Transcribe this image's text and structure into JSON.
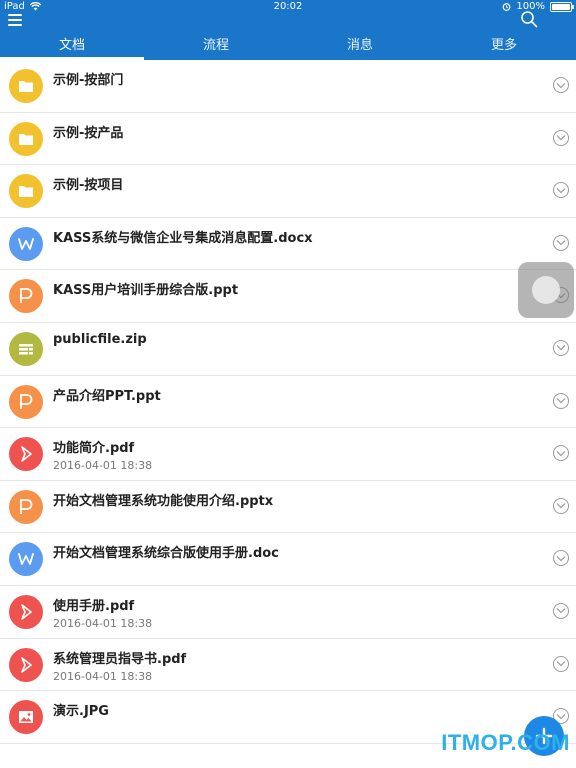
{
  "status_bar": {
    "device": "iPad",
    "time": "20:02",
    "battery": "100%"
  },
  "tabs": [
    {
      "label": "文档",
      "active": true
    },
    {
      "label": "流程",
      "active": false
    },
    {
      "label": "消息",
      "active": false
    },
    {
      "label": "更多",
      "active": false
    }
  ],
  "files": [
    {
      "name": "示例-按部门",
      "date": "",
      "type": "folder",
      "color": "#f2c12e"
    },
    {
      "name": "示例-按产品",
      "date": "",
      "type": "folder",
      "color": "#f2c12e"
    },
    {
      "name": "示例-按项目",
      "date": "",
      "type": "folder",
      "color": "#f2c12e"
    },
    {
      "name": "KASS系统与微信企业号集成消息配置.docx",
      "date": "",
      "type": "word",
      "color": "#5b9cf0"
    },
    {
      "name": "KASS用户培训手册综合版.ppt",
      "date": "",
      "type": "ppt",
      "color": "#f6914a"
    },
    {
      "name": "publicfile.zip",
      "date": "",
      "type": "zip",
      "color": "#b3b841"
    },
    {
      "name": "产品介绍PPT.ppt",
      "date": "",
      "type": "ppt",
      "color": "#f6914a"
    },
    {
      "name": "功能简介.pdf",
      "date": "2016-04-01 18:38",
      "type": "pdf",
      "color": "#ef5350"
    },
    {
      "name": "开始文档管理系统功能使用介绍.pptx",
      "date": "",
      "type": "ppt",
      "color": "#f6914a"
    },
    {
      "name": "开始文档管理系统综合版使用手册.doc",
      "date": "",
      "type": "word",
      "color": "#5b9cf0"
    },
    {
      "name": "使用手册.pdf",
      "date": "2016-04-01 18:38",
      "type": "pdf",
      "color": "#ef5350"
    },
    {
      "name": "系统管理员指导书.pdf",
      "date": "2016-04-01 18:38",
      "type": "pdf",
      "color": "#ef5350"
    },
    {
      "name": "演示.JPG",
      "date": "",
      "type": "image",
      "color": "#ef5350"
    }
  ],
  "watermark": "ITMOP.COM",
  "colors": {
    "header": "#1976c8",
    "fab": "#1e88e5"
  }
}
